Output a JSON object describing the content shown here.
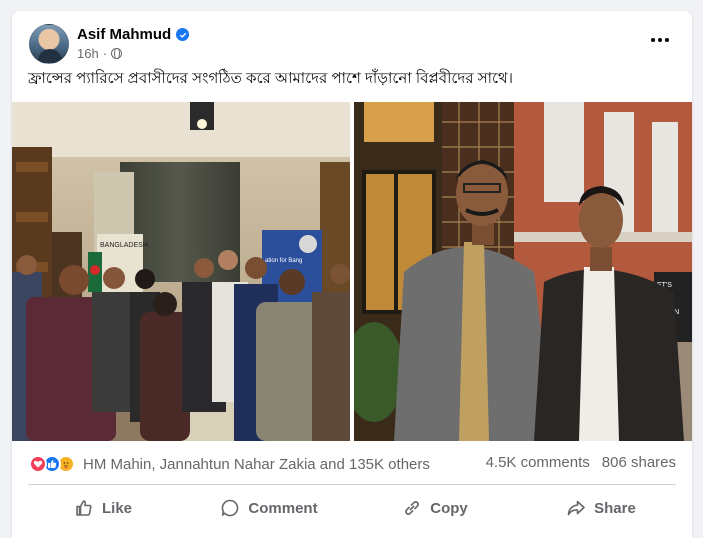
{
  "post": {
    "author": "Asif Mahmud",
    "time": "16h",
    "caption": "ফ্রান্সের প্যারিসে প্রবাসীদের সংগঠিত করে আমাদের পাশে দাঁড়ানো বিপ্লবীদের সাথে।",
    "icons": {
      "verified": "verified-badge-icon",
      "audience": "globe-icon",
      "more": "more-options-icon"
    }
  },
  "photos": {
    "left": {
      "banner_top": "BANGLADESH",
      "banner_side": "ation for Bang"
    },
    "right": {
      "sign_text": "ET'S\nEET\nORE\nEMAIN"
    }
  },
  "engagement": {
    "reactors": "HM Mahin, Jannahtun Nahar Zakia and 135K others",
    "comments": "4.5K comments",
    "shares": "806 shares",
    "reaction_icons": [
      "love-icon",
      "like-icon",
      "care-icon"
    ]
  },
  "actions": {
    "like": "Like",
    "comment": "Comment",
    "copy": "Copy",
    "share": "Share"
  },
  "colors": {
    "accent": "#1877f2",
    "love": "#f33e58",
    "care": "#f7b125",
    "secondary_text": "#65676b"
  }
}
